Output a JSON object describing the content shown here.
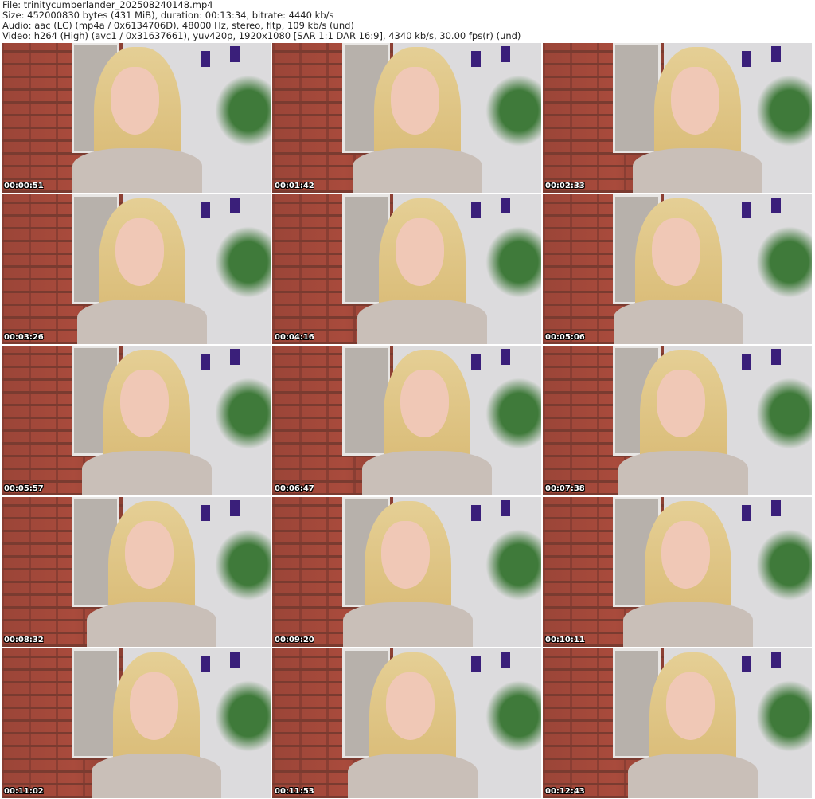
{
  "header": {
    "file": "File: trinitycumberlander_202508240148.mp4",
    "size": "Size: 452000830 bytes (431 MiB), duration: 00:13:34, bitrate: 4440 kb/s",
    "audio": "Audio: aac (LC) (mp4a / 0x6134706D), 48000 Hz, stereo, fltp, 109 kb/s (und)",
    "video": "Video: h264 (High) (avc1 / 0x31637661), yuv420p, 1920x1080 [SAR 1:1 DAR 16:9], 4340 kb/s, 30.00 fps(r) (und)"
  },
  "thumbnails": [
    {
      "timestamp": "00:00:51"
    },
    {
      "timestamp": "00:01:42"
    },
    {
      "timestamp": "00:02:33"
    },
    {
      "timestamp": "00:03:26"
    },
    {
      "timestamp": "00:04:16"
    },
    {
      "timestamp": "00:05:06"
    },
    {
      "timestamp": "00:05:57"
    },
    {
      "timestamp": "00:06:47"
    },
    {
      "timestamp": "00:07:38"
    },
    {
      "timestamp": "00:08:32"
    },
    {
      "timestamp": "00:09:20"
    },
    {
      "timestamp": "00:10:11"
    },
    {
      "timestamp": "00:11:02"
    },
    {
      "timestamp": "00:11:53"
    },
    {
      "timestamp": "00:12:43"
    }
  ]
}
